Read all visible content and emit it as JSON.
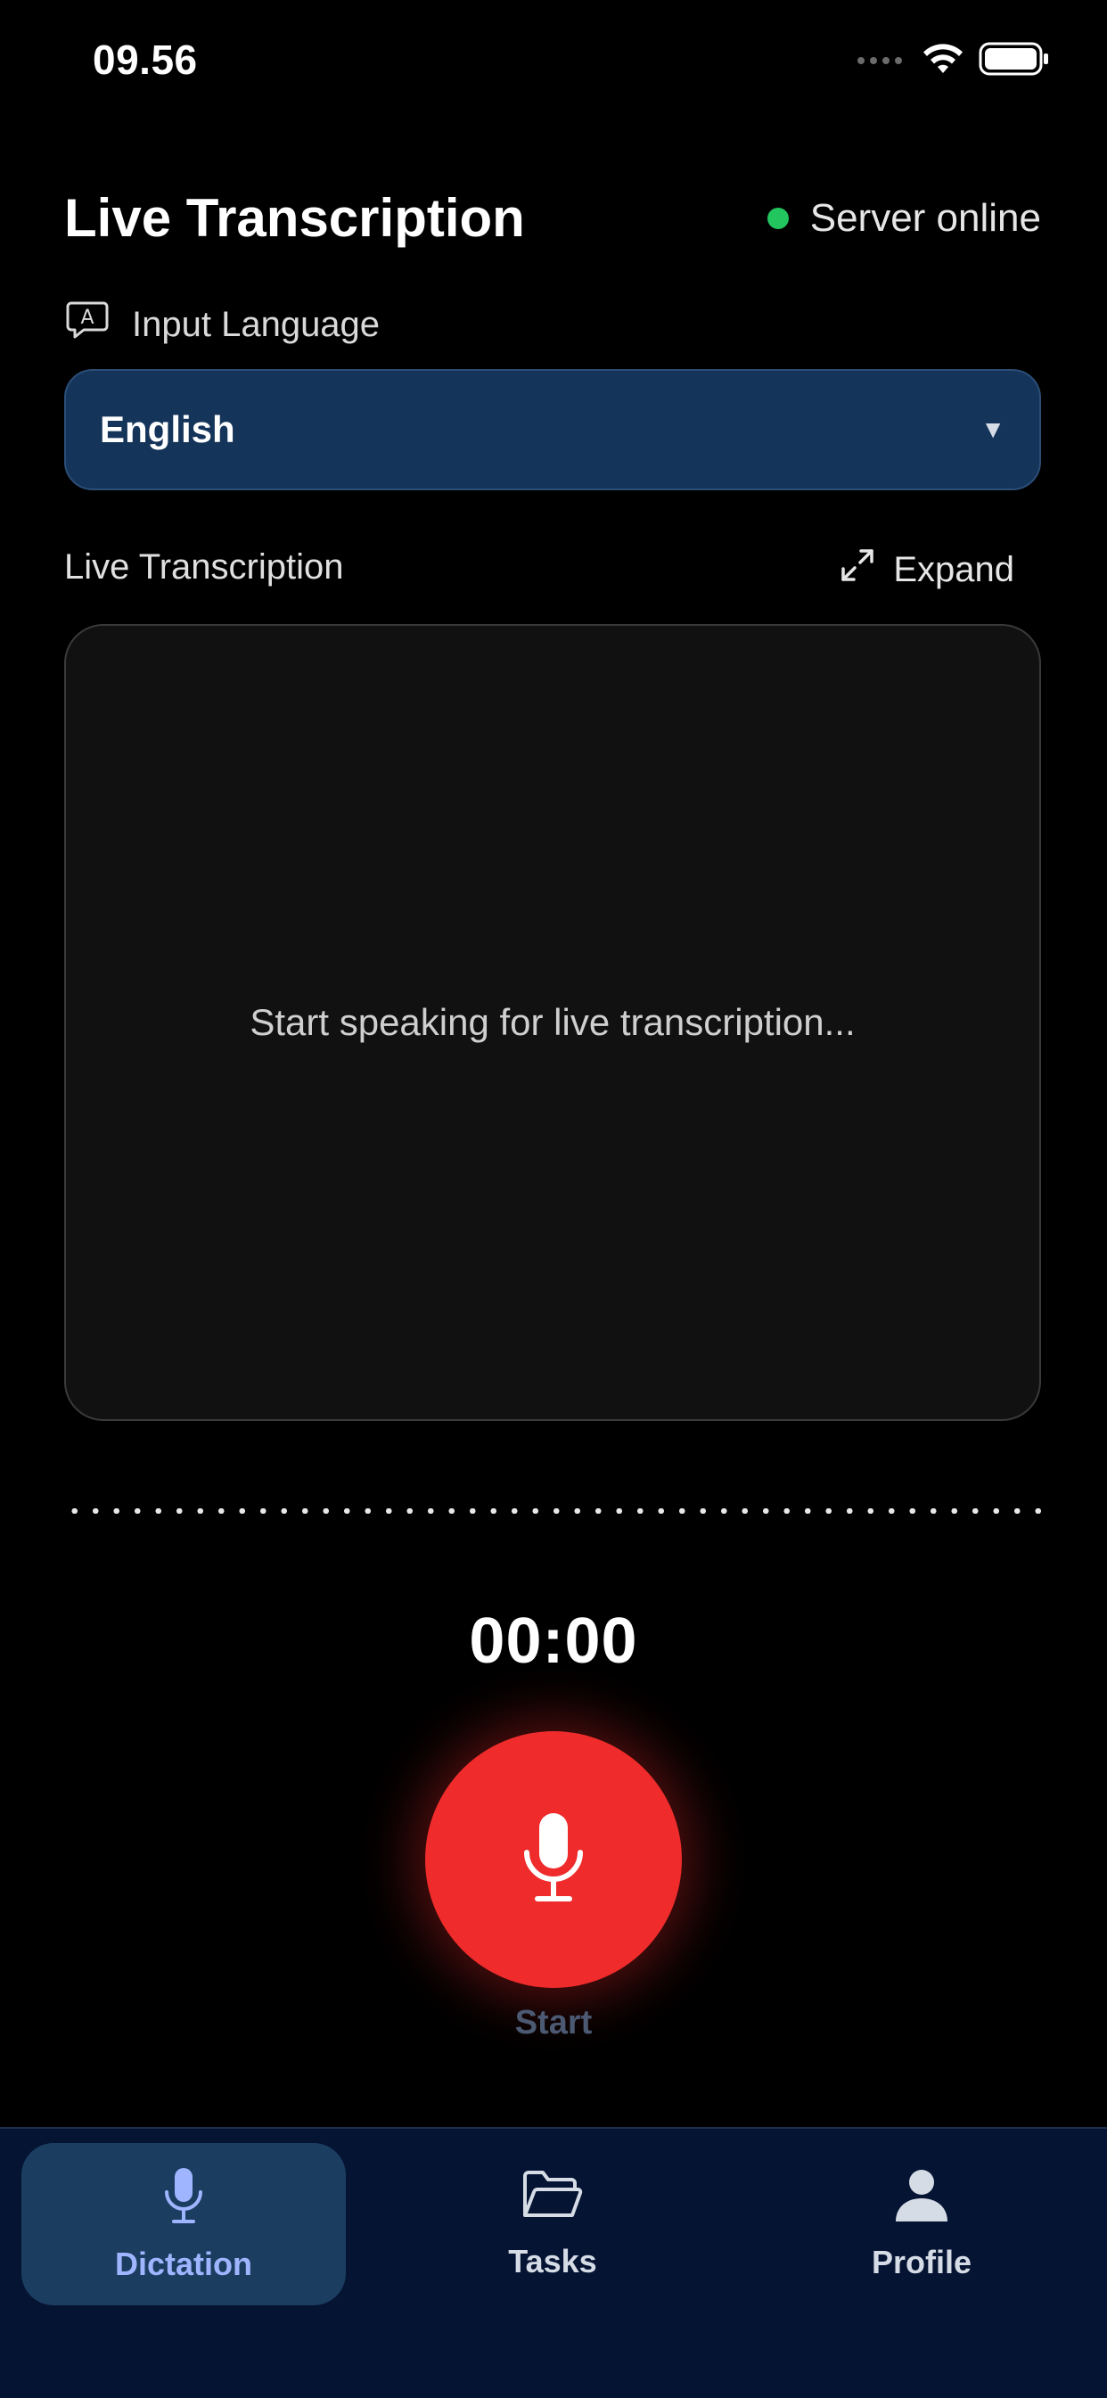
{
  "status_bar": {
    "time": "09.56",
    "icons": [
      "signal-icon",
      "wifi-icon",
      "battery-icon"
    ]
  },
  "header": {
    "title": "Live Transcription",
    "server_status": "Server online",
    "status_color": "#22c55e"
  },
  "language": {
    "label": "Input Language",
    "label_icon": "language-icon",
    "selected": "English",
    "caret": "▼"
  },
  "transcription": {
    "label": "Live Transcription",
    "expand_label": "Expand",
    "placeholder": "Start speaking for live transcription..."
  },
  "recorder": {
    "timer": "00:00",
    "button_label": "Start",
    "button_color": "#ef2b2b"
  },
  "nav": {
    "items": [
      {
        "label": "Dictation",
        "icon": "microphone-icon",
        "active": true
      },
      {
        "label": "Tasks",
        "icon": "folder-icon",
        "active": false
      },
      {
        "label": "Profile",
        "icon": "person-icon",
        "active": false
      }
    ],
    "active_color": "#9fb5ff"
  }
}
